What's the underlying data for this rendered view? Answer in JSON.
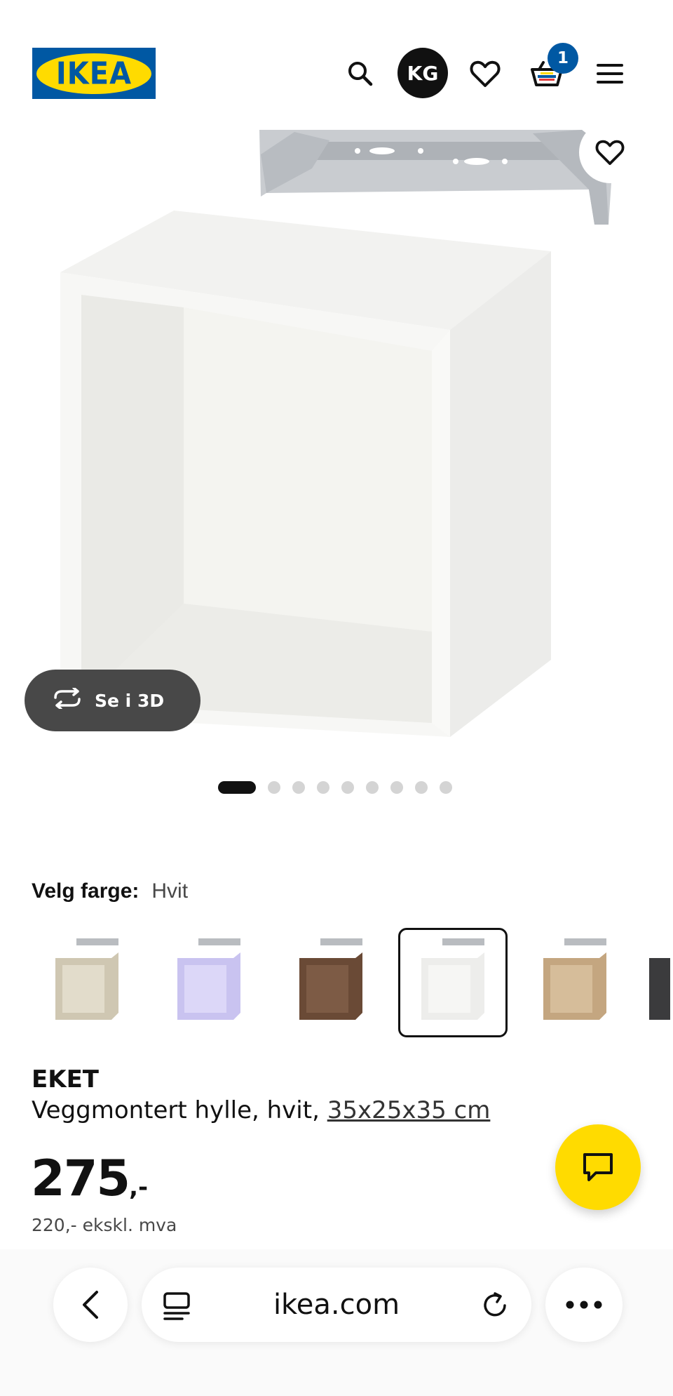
{
  "header": {
    "logo_text": "IKEA",
    "avatar_initials": "KG",
    "cart_count": "1",
    "icons": [
      "search-icon",
      "heart-icon",
      "cart-icon",
      "menu-icon"
    ]
  },
  "gallery": {
    "view_3d_label": "Se i 3D",
    "slide_count": 9,
    "active_slide": 1
  },
  "color": {
    "label": "Velg farge:",
    "value": "Hvit",
    "swatches": [
      "beige",
      "lilac",
      "walnut",
      "white",
      "oak",
      "dark-grey"
    ],
    "selected_index": 3
  },
  "product": {
    "name": "EKET",
    "description": "Veggmontert hylle, hvit,",
    "size": "35x25x35 cm",
    "price": "275",
    "price_suffix": ",-",
    "price_ex_vat": "220,- ekskl. mva"
  },
  "browser": {
    "url": "ikea.com"
  },
  "colors": {
    "ikea_blue": "#0058a3",
    "ikea_yellow": "#ffdb00"
  }
}
